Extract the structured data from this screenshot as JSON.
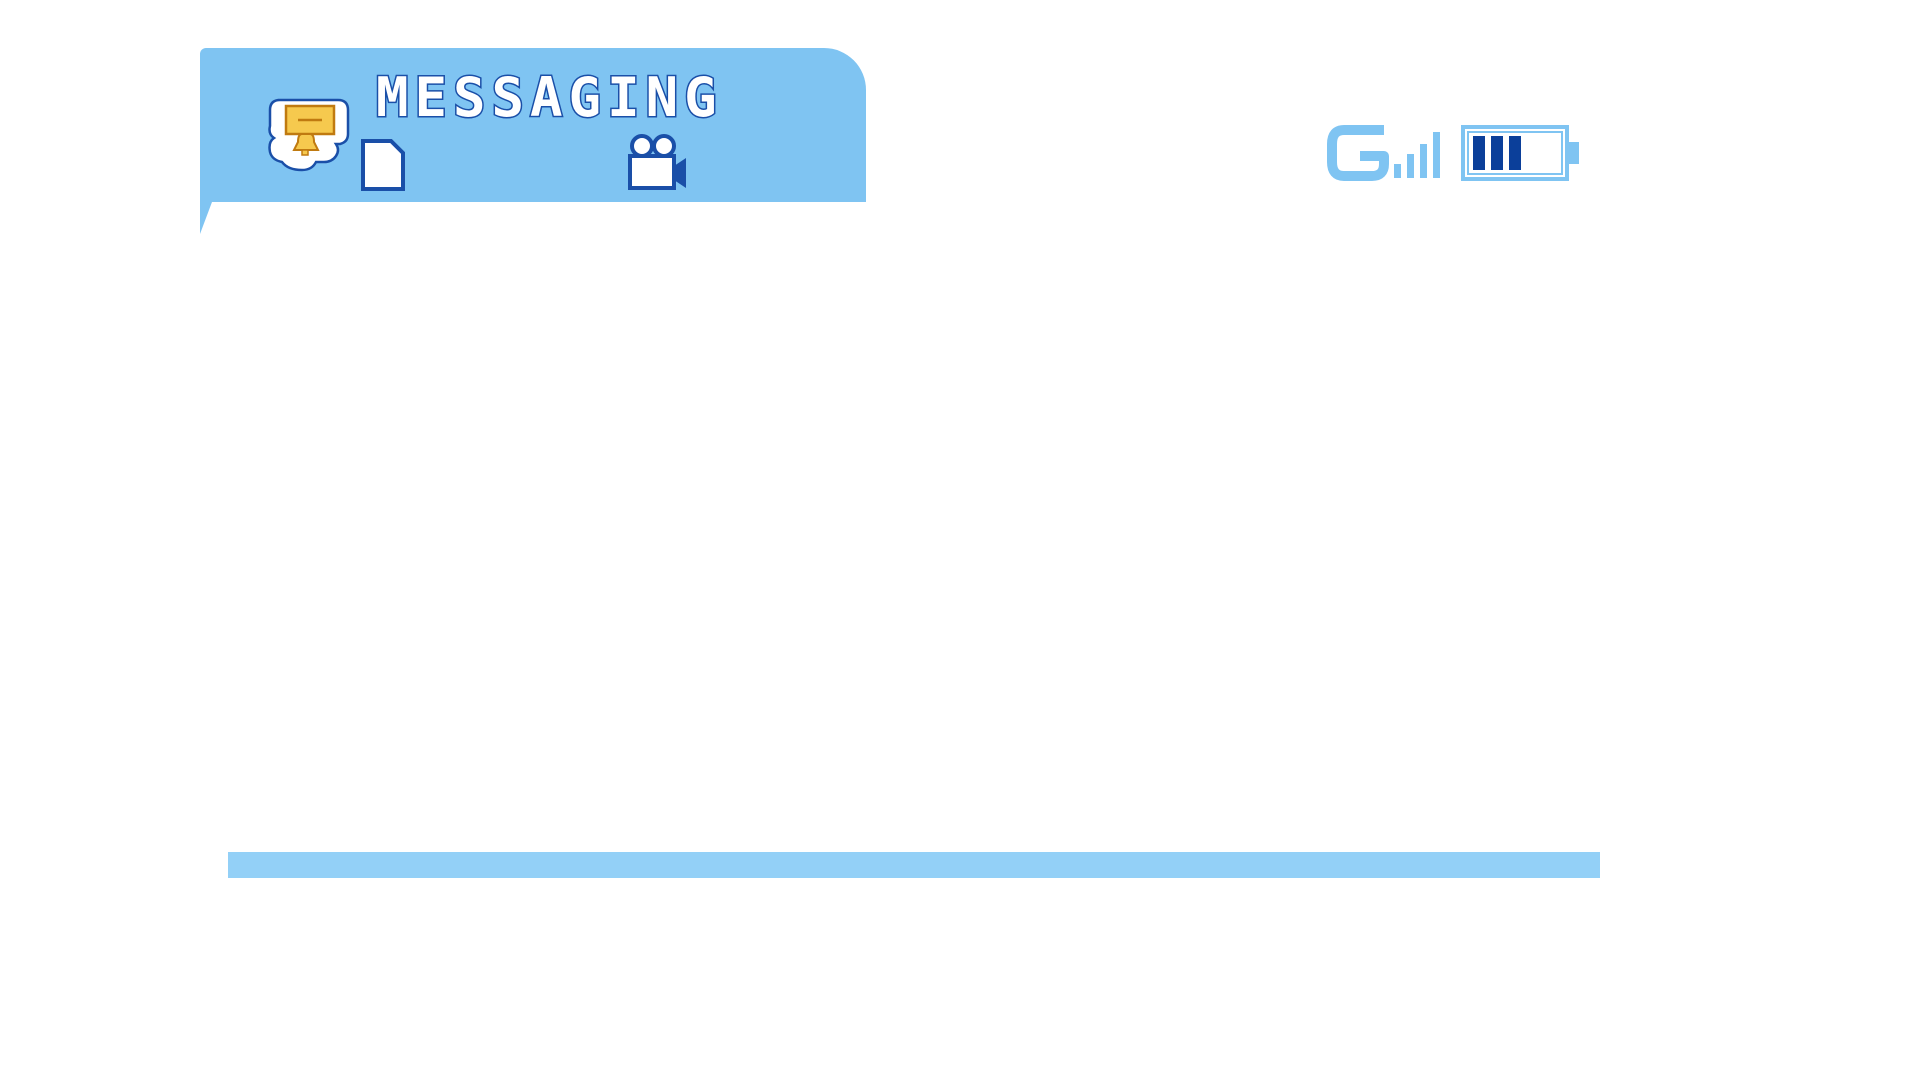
{
  "app": {
    "title": "MESSAGING",
    "icons": [
      "message-notification-icon",
      "document-icon",
      "video-camera-icon"
    ]
  },
  "status": {
    "network_type": "G",
    "signal_strength": "4/4",
    "battery_level": "3/5"
  },
  "colors": {
    "panel": "#7fc4f2",
    "title_outline": "#1a4fa8",
    "accent_dark": "#0b3f9a",
    "accent_light": "#7fc4f2",
    "bar": "#93d0f7",
    "icon_yellow": "#f6c94e"
  }
}
